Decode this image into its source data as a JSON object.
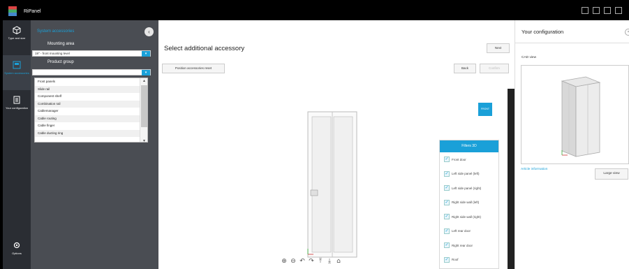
{
  "app": {
    "title": "RiPanel"
  },
  "leftbar": {
    "items": [
      {
        "label": "Type and size",
        "icon": "cube-icon"
      },
      {
        "label": "System accessories",
        "icon": "accessories-icon"
      },
      {
        "label": "Your configuration",
        "icon": "document-icon"
      }
    ],
    "options_label": "Options"
  },
  "panel": {
    "header": "System accessories",
    "mounting_area_label": "Mounting area",
    "mounting_area_value": "19\" - front mounting level",
    "product_group_label": "Product group",
    "product_group_value": "",
    "dropdown_items": [
      "Front panels",
      "Slide rail",
      "Component shelf",
      "Combination rail",
      "Cablemanager",
      "Cable routing",
      "Cable finger",
      "Cable ducting ring"
    ]
  },
  "main": {
    "title": "Select additional accessory",
    "next_label": "Next",
    "reset_label": "Position accessories reset",
    "back_label": "Back",
    "confirm_label": "Confirm",
    "front_label": "FRONT",
    "filters": {
      "header": "Filters 3D",
      "items": [
        "Front door",
        "Left side panel (left)",
        "Left side panel (right)",
        "Right side wall (left)",
        "Right side wall (right)",
        "Left rear door",
        "Right rear door",
        "Roof"
      ]
    }
  },
  "right": {
    "title": "Your configuration",
    "cad_label": "CAD view",
    "article_info": "Article information",
    "large_view": "Large view"
  },
  "colors": {
    "accent": "#1aa0d8",
    "sidebar": "#2a2d33",
    "panel": "#4a4d53"
  }
}
